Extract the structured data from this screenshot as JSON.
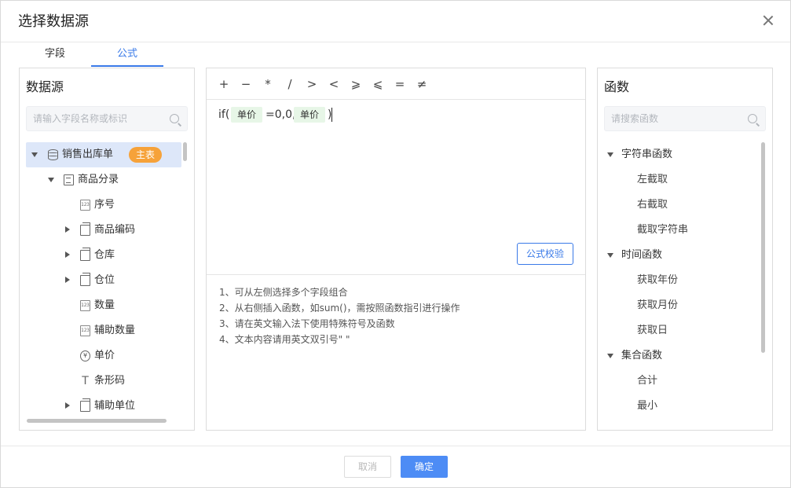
{
  "dialog": {
    "title": "选择数据源"
  },
  "tabs": [
    {
      "label": "字段"
    },
    {
      "label": "公式"
    }
  ],
  "active_tab": "公式",
  "left_panel": {
    "title": "数据源",
    "search_placeholder": "请输入字段名称或标识",
    "root": {
      "label": "销售出库单",
      "badge": "主表",
      "icon": "database-icon"
    },
    "group": {
      "label": "商品分录",
      "icon": "document-icon"
    },
    "fields": [
      {
        "label": "序号",
        "icon": "number-field-icon",
        "expandable": false
      },
      {
        "label": "商品编码",
        "icon": "reference-field-icon",
        "expandable": true
      },
      {
        "label": "仓库",
        "icon": "reference-field-icon",
        "expandable": true
      },
      {
        "label": "仓位",
        "icon": "reference-field-icon",
        "expandable": true
      },
      {
        "label": "数量",
        "icon": "number-field-icon",
        "expandable": false
      },
      {
        "label": "辅助数量",
        "icon": "number-field-icon",
        "expandable": false
      },
      {
        "label": "单价",
        "icon": "currency-field-icon",
        "expandable": false
      },
      {
        "label": "条形码",
        "icon": "text-field-icon",
        "expandable": false
      },
      {
        "label": "辅助单位",
        "icon": "reference-field-icon",
        "expandable": true
      }
    ],
    "number_icon_text": "123",
    "currency_icon_text": "¥",
    "text_icon_text": "T"
  },
  "operators": [
    "+",
    "−",
    "*",
    "/",
    ">",
    "<",
    "⩾",
    "⩽",
    "=",
    "≠"
  ],
  "formula": {
    "prefix": "if(",
    "field_1": "单价",
    "middle": "=0,0,",
    "field_2": "单价",
    "suffix": ")"
  },
  "verify_button": "公式校验",
  "hints": [
    "1、可从左侧选择多个字段组合",
    "2、从右侧插入函数，如sum()，需按照函数指引进行操作",
    "3、请在英文输入法下使用特殊符号及函数",
    "4、文本内容请用英文双引号\" \""
  ],
  "right_panel": {
    "title": "函数",
    "search_placeholder": "请搜索函数",
    "groups": [
      {
        "label": "字符串函数",
        "items": [
          "左截取",
          "右截取",
          "截取字符串"
        ]
      },
      {
        "label": "时间函数",
        "items": [
          "获取年份",
          "获取月份",
          "获取日"
        ]
      },
      {
        "label": "集合函数",
        "items": [
          "合计",
          "最小"
        ]
      }
    ]
  },
  "footer": {
    "cancel": "取消",
    "confirm": "确定"
  },
  "colors": {
    "accent": "#3a7ae8",
    "primary_button": "#4d8cf5",
    "badge": "#f6a23a",
    "chip_bg": "#e7f6e7",
    "selected_row": "#dde7f9"
  }
}
